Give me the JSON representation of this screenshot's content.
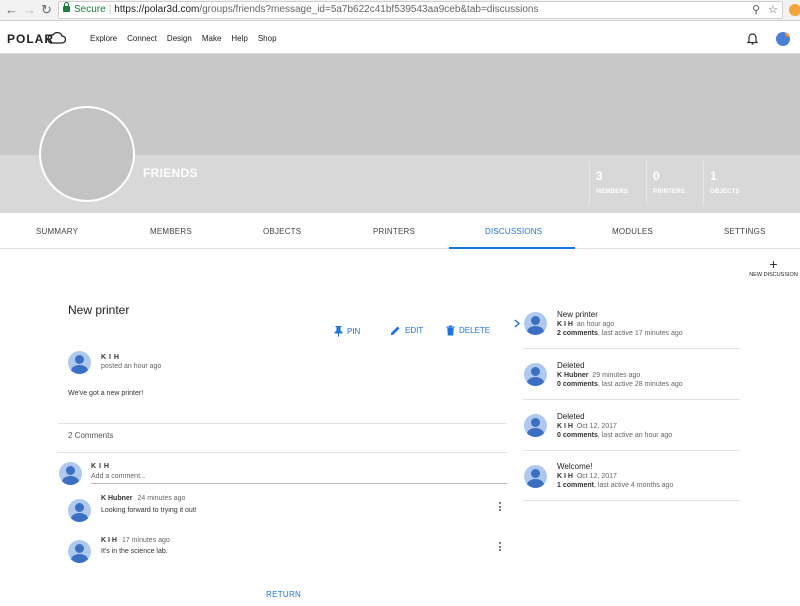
{
  "browser": {
    "secure_label": "Secure",
    "url_host": "https://polar3d.com",
    "url_rest": "/groups/friends?message_id=5a7b622c41bf539543aa9ceb&tab=discussions"
  },
  "nav": {
    "logo": "POLAR",
    "items": [
      "Explore",
      "Connect",
      "Design",
      "Make",
      "Help",
      "Shop"
    ]
  },
  "group": {
    "name": "FRIENDS",
    "stats": [
      {
        "num": "3",
        "label": "MEMBERS"
      },
      {
        "num": "0",
        "label": "PRINTERS"
      },
      {
        "num": "1",
        "label": "OBJECTS"
      }
    ]
  },
  "tabs": [
    "SUMMARY",
    "MEMBERS",
    "OBJECTS",
    "PRINTERS",
    "DISCUSSIONS",
    "MODULES",
    "SETTINGS"
  ],
  "new_discussion": {
    "icon": "+",
    "label": "NEW DISCUSSION"
  },
  "post": {
    "title": "New printer",
    "actions": {
      "pin": "PIN",
      "edit": "EDIT",
      "delete": "DELETE"
    },
    "author": "K I H",
    "posted": "posted an hour ago",
    "body": "We've got a new printer!",
    "comments_count": "2 Comments",
    "compose": {
      "author": "K I H",
      "placeholder": "Add a comment..."
    },
    "comments": [
      {
        "author": "K Hubner",
        "time": "24 minutes ago",
        "text": "Looking forward to trying it out!"
      },
      {
        "author": "K I H",
        "time": "17 minutes ago",
        "text": "It's in the science lab."
      }
    ],
    "return_label": "RETURN"
  },
  "discussions": [
    {
      "title": "New printer",
      "author": "K I H",
      "time": "an hour ago",
      "comments": "2 comments",
      "active": ", last active 17 minutes ago"
    },
    {
      "title": "Deleted",
      "author": "K Hubner",
      "time": "29 minutes ago",
      "comments": "0 comments",
      "active": ", last active 28 minutes ago"
    },
    {
      "title": "Deleted",
      "author": "K I H",
      "time": "Oct 12, 2017",
      "comments": "0 comments",
      "active": ", last active an hour ago"
    },
    {
      "title": "Welcome!",
      "author": "K I H",
      "time": "Oct 12, 2017",
      "comments": "1 comment",
      "active": ", last active 4 months ago"
    }
  ]
}
